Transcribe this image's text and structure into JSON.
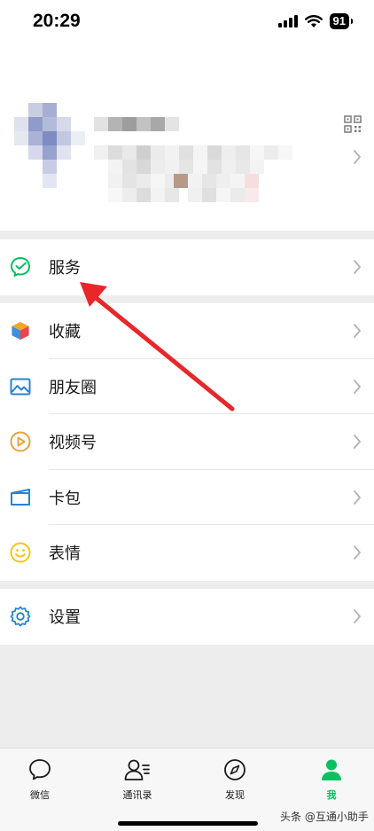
{
  "status_bar": {
    "time": "20:29",
    "battery": "91"
  },
  "profile": {
    "qr_icon": "qr-code-icon",
    "chevron_icon": "chevron-right-icon"
  },
  "menu_groups": [
    [
      {
        "label": "服务",
        "icon": "service-check-icon",
        "color": "#07c160"
      }
    ],
    [
      {
        "label": "收藏",
        "icon": "favorites-cube-icon",
        "color": "#f0b429"
      },
      {
        "label": "朋友圈",
        "icon": "moments-image-icon",
        "color": "#2782d7"
      },
      {
        "label": "视频号",
        "icon": "channels-play-icon",
        "color": "#e8a33d"
      },
      {
        "label": "卡包",
        "icon": "card-wallet-icon",
        "color": "#2782d7"
      },
      {
        "label": "表情",
        "icon": "sticker-smile-icon",
        "color": "#f5c518"
      }
    ],
    [
      {
        "label": "设置",
        "icon": "settings-gear-icon",
        "color": "#2782d7"
      }
    ]
  ],
  "tabs": [
    {
      "label": "微信",
      "icon": "chat-bubble-icon",
      "active": false
    },
    {
      "label": "通讯录",
      "icon": "contacts-icon",
      "active": false
    },
    {
      "label": "发现",
      "icon": "compass-icon",
      "active": false
    },
    {
      "label": "我",
      "icon": "person-icon",
      "active": true
    }
  ],
  "colors": {
    "accent": "#07c160",
    "annotation_arrow": "#e8272a",
    "background": "#ededed"
  },
  "watermark": "头条 @互通小助手"
}
